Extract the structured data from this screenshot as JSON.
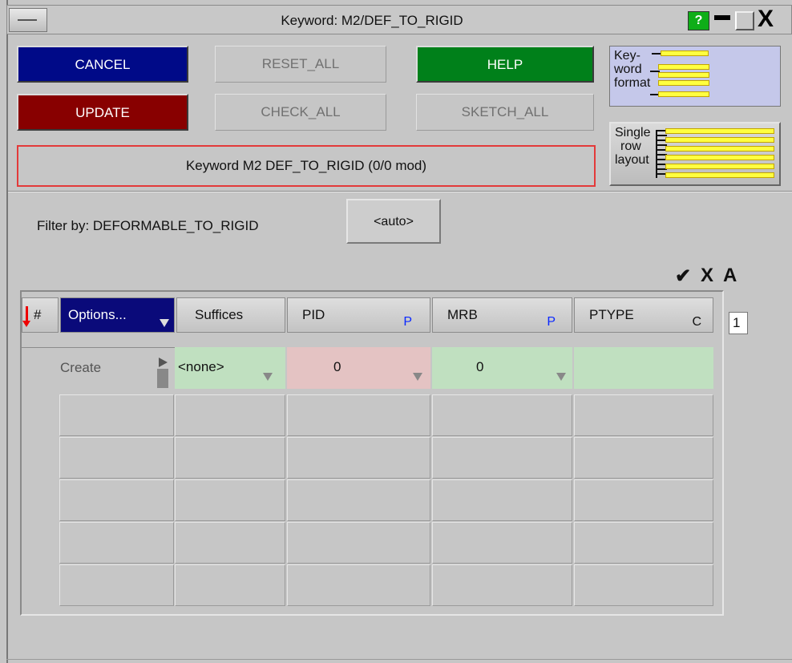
{
  "window": {
    "title": "Keyword: M2/DEF_TO_RIGID",
    "help_glyph": "?",
    "close_glyph": "X"
  },
  "buttons": {
    "cancel": "CANCEL",
    "update": "UPDATE",
    "reset_all": "RESET_ALL",
    "check_all": "CHECK_ALL",
    "help": "HELP",
    "sketch_all": "SKETCH_ALL"
  },
  "status": "Keyword M2 DEF_TO_RIGID (0/0 mod)",
  "side_panels": {
    "keyword_format": [
      "Key-",
      "word",
      "format"
    ],
    "single_row_layout": [
      "Single",
      "row",
      "layout"
    ]
  },
  "filter": {
    "label": "Filter by: DEFORMABLE_TO_RIGID",
    "auto_button": "<auto>"
  },
  "tool_icons": {
    "accept": "✔",
    "reject": "X",
    "attribute": "A"
  },
  "table": {
    "columns": [
      {
        "label": "#"
      },
      {
        "label": "Options..."
      },
      {
        "label": "Suffices"
      },
      {
        "label": "PID",
        "tag": "P"
      },
      {
        "label": "MRB",
        "tag": "P"
      },
      {
        "label": "PTYPE",
        "tag": "C"
      }
    ],
    "row_count": "1",
    "create_row": {
      "label": "Create",
      "suffix": "<none>",
      "pid": "0",
      "mrb": "0",
      "ptype": ""
    }
  },
  "colors": {
    "cancel": "#000a88",
    "update": "#880000",
    "help": "#00801a",
    "options_header": "#0a0a7a",
    "pid_cell": "#e4c3c3",
    "green_cell": "#c0e0c0",
    "status_border": "#e33a3a"
  }
}
